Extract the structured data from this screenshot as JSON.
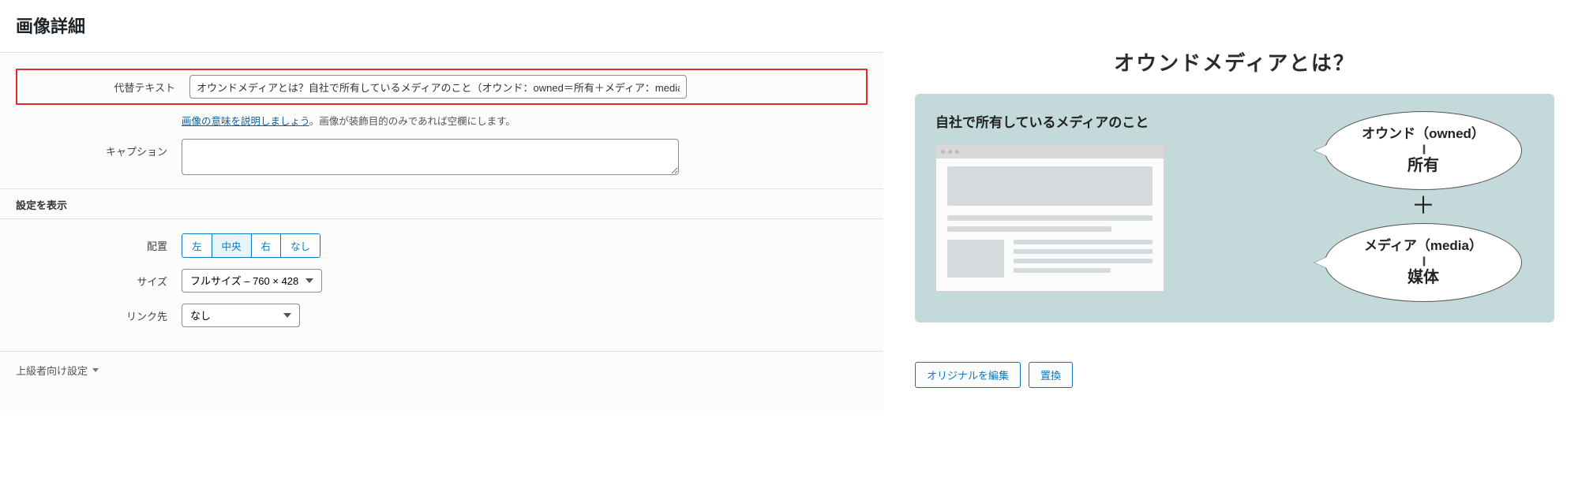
{
  "title": "画像詳細",
  "form": {
    "alt_label": "代替テキスト",
    "alt_value": "オウンドメディアとは？自社で所有しているメディアのこと（オウンド：owned＝所有＋メディア：media＝媒体）",
    "alt_help_link": "画像の意味を説明しましょう",
    "alt_help_rest": "。画像が装飾目的のみであれば空欄にします。",
    "caption_label": "キャプション",
    "caption_value": ""
  },
  "display": {
    "section_label": "設定を表示",
    "align_label": "配置",
    "align_options": {
      "left": "左",
      "center": "中央",
      "right": "右",
      "none": "なし"
    },
    "align_active": "center",
    "size_label": "サイズ",
    "size_value": "フルサイズ – 760 × 428",
    "link_label": "リンク先",
    "link_value": "なし"
  },
  "advanced_label": "上級者向け設定",
  "preview": {
    "title": "オウンドメディアとは？",
    "subtitle": "自社で所有しているメディアのこと",
    "bubble1_top": "オウンド（owned）",
    "bubble1_bot": "所有",
    "bubble2_top": "メディア（media）",
    "bubble2_bot": "媒体",
    "actions": {
      "edit": "オリジナルを編集",
      "replace": "置換"
    }
  }
}
